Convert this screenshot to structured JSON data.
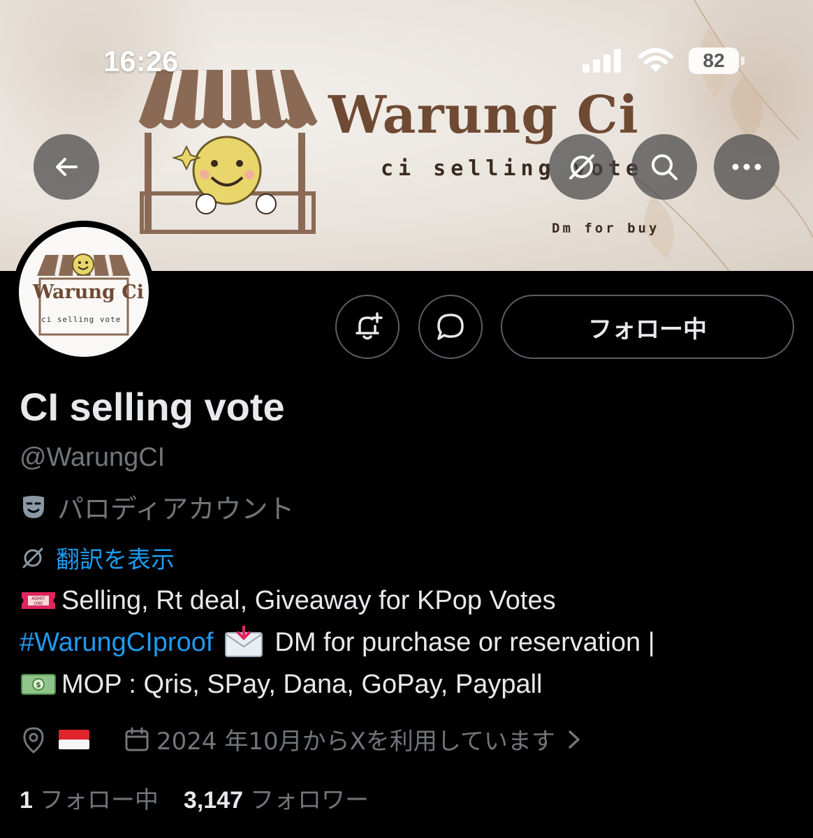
{
  "status_bar": {
    "time": "16:26",
    "battery": "82"
  },
  "banner": {
    "brand_title": "Warung Ci",
    "tagline": "ci selling vote",
    "dm_text": "Dm for buy"
  },
  "avatar": {
    "brand_title": "Warung Ci",
    "tagline": "ci selling vote"
  },
  "actions": {
    "follow_label": "フォロー中"
  },
  "profile": {
    "display_name": "CI selling vote",
    "handle": "@WarungCI",
    "parody_label": "パロディアカウント",
    "translate_label": "翻訳を表示",
    "bio": {
      "line1": "Selling, Rt deal, Giveaway for KPop Votes",
      "hashtag": "#WarungCIproof",
      "line2_rest": "DM for purchase or reservation |",
      "line3": "MOP : Qris, SPay, Dana, GoPay, Paypall"
    },
    "joined": "2024 年10月からXを利用しています"
  },
  "stats": {
    "following_count": "1",
    "following_label": "フォロー中",
    "followers_count": "3,147",
    "followers_label": "フォロワー"
  },
  "icons": [
    "back-arrow-icon",
    "translate-off-icon",
    "search-icon",
    "more-icon",
    "notification-bell-plus-icon",
    "message-bubble-icon",
    "theater-mask-icon",
    "translate-icon",
    "admit-ticket-icon",
    "envelope-icon",
    "money-icon",
    "location-pin-icon",
    "indonesia-flag-icon",
    "calendar-icon",
    "chevron-right-icon"
  ],
  "colors": {
    "link": "#1d9bf0",
    "muted": "#71767b",
    "text": "#e7e9ea",
    "brand_brown": "#6f4a33"
  }
}
